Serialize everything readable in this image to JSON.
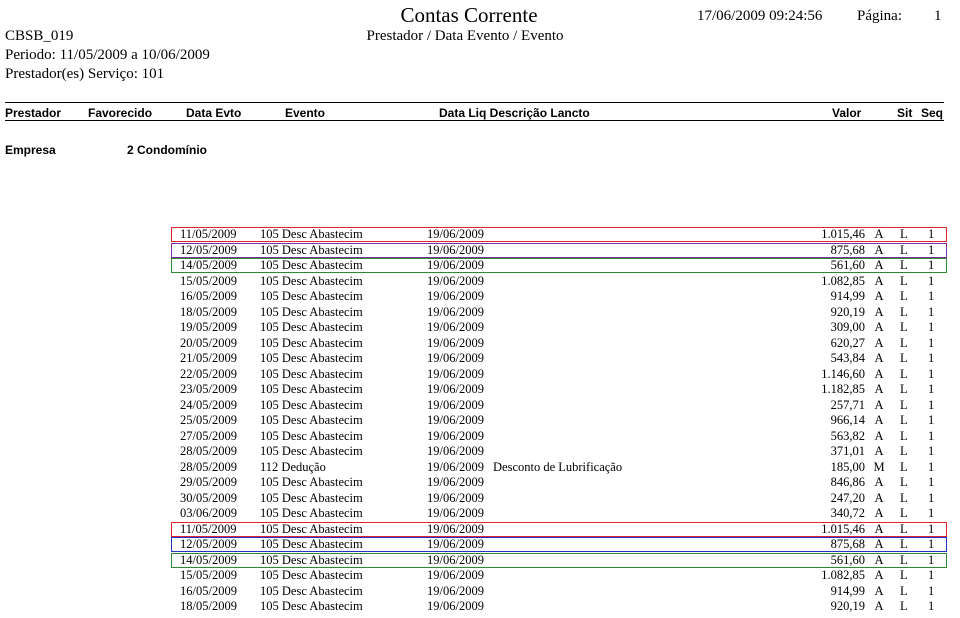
{
  "report": {
    "title": "Contas Corrente",
    "code": "CBSB_019",
    "subtitle": "Prestador / Data Evento / Evento",
    "datetime": "17/06/2009 09:24:56",
    "page_label": "Página:",
    "page_number": "1",
    "period": "Periodo: 11/05/2009 a 10/06/2009",
    "prestador_servico": "Prestador(es) Serviço: 101"
  },
  "columns": {
    "prestador": "Prestador",
    "favorecido": "Favorecido",
    "data_evto": "Data Evto",
    "evento": "Evento",
    "data_liq_desc": "Data Liq Descrição Lancto",
    "valor": "Valor",
    "sit": "Sit",
    "seq": "Seq"
  },
  "group": {
    "label": "Empresa",
    "value": "2  Condomínio"
  },
  "highlight_colors": {
    "red": "#e0242c",
    "purple": "#7b2fa3",
    "green": "#2e8a2e",
    "blue": "#2230c8"
  },
  "rows": [
    {
      "date": "11/05/2009",
      "event": "105 Desc Abastecim",
      "liq": "19/06/2009",
      "desc": "",
      "value": "1.015,46",
      "status": "A",
      "sit": "L",
      "seq": "1",
      "highlight": "red"
    },
    {
      "date": "12/05/2009",
      "event": "105 Desc Abastecim",
      "liq": "19/06/2009",
      "desc": "",
      "value": "875,68",
      "status": "A",
      "sit": "L",
      "seq": "1",
      "highlight": "purple"
    },
    {
      "date": "14/05/2009",
      "event": "105 Desc Abastecim",
      "liq": "19/06/2009",
      "desc": "",
      "value": "561,60",
      "status": "A",
      "sit": "L",
      "seq": "1",
      "highlight": "green"
    },
    {
      "date": "15/05/2009",
      "event": "105 Desc Abastecim",
      "liq": "19/06/2009",
      "desc": "",
      "value": "1.082,85",
      "status": "A",
      "sit": "L",
      "seq": "1",
      "highlight": ""
    },
    {
      "date": "16/05/2009",
      "event": "105 Desc Abastecim",
      "liq": "19/06/2009",
      "desc": "",
      "value": "914,99",
      "status": "A",
      "sit": "L",
      "seq": "1",
      "highlight": ""
    },
    {
      "date": "18/05/2009",
      "event": "105 Desc Abastecim",
      "liq": "19/06/2009",
      "desc": "",
      "value": "920,19",
      "status": "A",
      "sit": "L",
      "seq": "1",
      "highlight": ""
    },
    {
      "date": "19/05/2009",
      "event": "105 Desc Abastecim",
      "liq": "19/06/2009",
      "desc": "",
      "value": "309,00",
      "status": "A",
      "sit": "L",
      "seq": "1",
      "highlight": ""
    },
    {
      "date": "20/05/2009",
      "event": "105 Desc Abastecim",
      "liq": "19/06/2009",
      "desc": "",
      "value": "620,27",
      "status": "A",
      "sit": "L",
      "seq": "1",
      "highlight": ""
    },
    {
      "date": "21/05/2009",
      "event": "105 Desc Abastecim",
      "liq": "19/06/2009",
      "desc": "",
      "value": "543,84",
      "status": "A",
      "sit": "L",
      "seq": "1",
      "highlight": ""
    },
    {
      "date": "22/05/2009",
      "event": "105 Desc Abastecim",
      "liq": "19/06/2009",
      "desc": "",
      "value": "1.146,60",
      "status": "A",
      "sit": "L",
      "seq": "1",
      "highlight": ""
    },
    {
      "date": "23/05/2009",
      "event": "105 Desc Abastecim",
      "liq": "19/06/2009",
      "desc": "",
      "value": "1.182,85",
      "status": "A",
      "sit": "L",
      "seq": "1",
      "highlight": ""
    },
    {
      "date": "24/05/2009",
      "event": "105 Desc Abastecim",
      "liq": "19/06/2009",
      "desc": "",
      "value": "257,71",
      "status": "A",
      "sit": "L",
      "seq": "1",
      "highlight": ""
    },
    {
      "date": "25/05/2009",
      "event": "105 Desc Abastecim",
      "liq": "19/06/2009",
      "desc": "",
      "value": "966,14",
      "status": "A",
      "sit": "L",
      "seq": "1",
      "highlight": ""
    },
    {
      "date": "27/05/2009",
      "event": "105 Desc Abastecim",
      "liq": "19/06/2009",
      "desc": "",
      "value": "563,82",
      "status": "A",
      "sit": "L",
      "seq": "1",
      "highlight": ""
    },
    {
      "date": "28/05/2009",
      "event": "105 Desc Abastecim",
      "liq": "19/06/2009",
      "desc": "",
      "value": "371,01",
      "status": "A",
      "sit": "L",
      "seq": "1",
      "highlight": ""
    },
    {
      "date": "28/05/2009",
      "event": "112 Dedução",
      "liq": "19/06/2009",
      "desc": "Desconto de Lubrificação",
      "value": "185,00",
      "status": "M",
      "sit": "L",
      "seq": "1",
      "highlight": ""
    },
    {
      "date": "29/05/2009",
      "event": "105 Desc Abastecim",
      "liq": "19/06/2009",
      "desc": "",
      "value": "846,86",
      "status": "A",
      "sit": "L",
      "seq": "1",
      "highlight": ""
    },
    {
      "date": "30/05/2009",
      "event": "105 Desc Abastecim",
      "liq": "19/06/2009",
      "desc": "",
      "value": "247,20",
      "status": "A",
      "sit": "L",
      "seq": "1",
      "highlight": ""
    },
    {
      "date": "03/06/2009",
      "event": "105 Desc Abastecim",
      "liq": "19/06/2009",
      "desc": "",
      "value": "340,72",
      "status": "A",
      "sit": "L",
      "seq": "1",
      "highlight": ""
    },
    {
      "date": "11/05/2009",
      "event": "105 Desc Abastecim",
      "liq": "19/06/2009",
      "desc": "",
      "value": "1.015,46",
      "status": "A",
      "sit": "L",
      "seq": "1",
      "highlight": "red"
    },
    {
      "date": "12/05/2009",
      "event": "105 Desc Abastecim",
      "liq": "19/06/2009",
      "desc": "",
      "value": "875,68",
      "status": "A",
      "sit": "L",
      "seq": "1",
      "highlight": "blue"
    },
    {
      "date": "14/05/2009",
      "event": "105 Desc Abastecim",
      "liq": "19/06/2009",
      "desc": "",
      "value": "561,60",
      "status": "A",
      "sit": "L",
      "seq": "1",
      "highlight": "green"
    },
    {
      "date": "15/05/2009",
      "event": "105 Desc Abastecim",
      "liq": "19/06/2009",
      "desc": "",
      "value": "1.082,85",
      "status": "A",
      "sit": "L",
      "seq": "1",
      "highlight": ""
    },
    {
      "date": "16/05/2009",
      "event": "105 Desc Abastecim",
      "liq": "19/06/2009",
      "desc": "",
      "value": "914,99",
      "status": "A",
      "sit": "L",
      "seq": "1",
      "highlight": ""
    },
    {
      "date": "18/05/2009",
      "event": "105 Desc Abastecim",
      "liq": "19/06/2009",
      "desc": "",
      "value": "920,19",
      "status": "A",
      "sit": "L",
      "seq": "1",
      "highlight": ""
    }
  ]
}
